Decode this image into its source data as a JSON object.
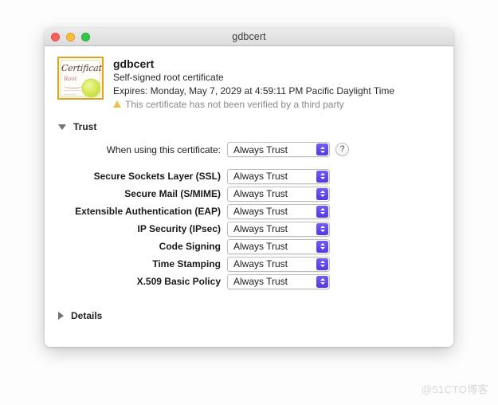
{
  "window": {
    "title": "gdbcert",
    "traffic_lights": [
      "close",
      "minimize",
      "maximize"
    ]
  },
  "certificate": {
    "name": "gdbcert",
    "kind": "Self-signed root certificate",
    "expires": "Expires: Monday, May 7, 2029 at 4:59:11 PM Pacific Daylight Time",
    "warning": "This certificate has not been verified by a third party",
    "icon": {
      "title": "Certificate",
      "subtitle": "Root"
    }
  },
  "trust_section": {
    "label": "Trust",
    "expanded": true,
    "primary": {
      "label": "When using this certificate:",
      "value": "Always Trust",
      "help_label": "?"
    },
    "rows": [
      {
        "label": "Secure Sockets Layer (SSL)",
        "value": "Always Trust"
      },
      {
        "label": "Secure Mail (S/MIME)",
        "value": "Always Trust"
      },
      {
        "label": "Extensible Authentication (EAP)",
        "value": "Always Trust"
      },
      {
        "label": "IP Security (IPsec)",
        "value": "Always Trust"
      },
      {
        "label": "Code Signing",
        "value": "Always Trust"
      },
      {
        "label": "Time Stamping",
        "value": "Always Trust"
      },
      {
        "label": "X.509 Basic Policy",
        "value": "Always Trust"
      }
    ]
  },
  "details_section": {
    "label": "Details",
    "expanded": false
  },
  "watermark": "@51CTO博客",
  "colors": {
    "stepper_blue": "#5636e8",
    "warning_amber": "#e8c44a",
    "cert_border_gold": "#d9a520",
    "traffic_red": "#fc615d",
    "traffic_yellow": "#fdbc40",
    "traffic_green": "#34c749"
  }
}
